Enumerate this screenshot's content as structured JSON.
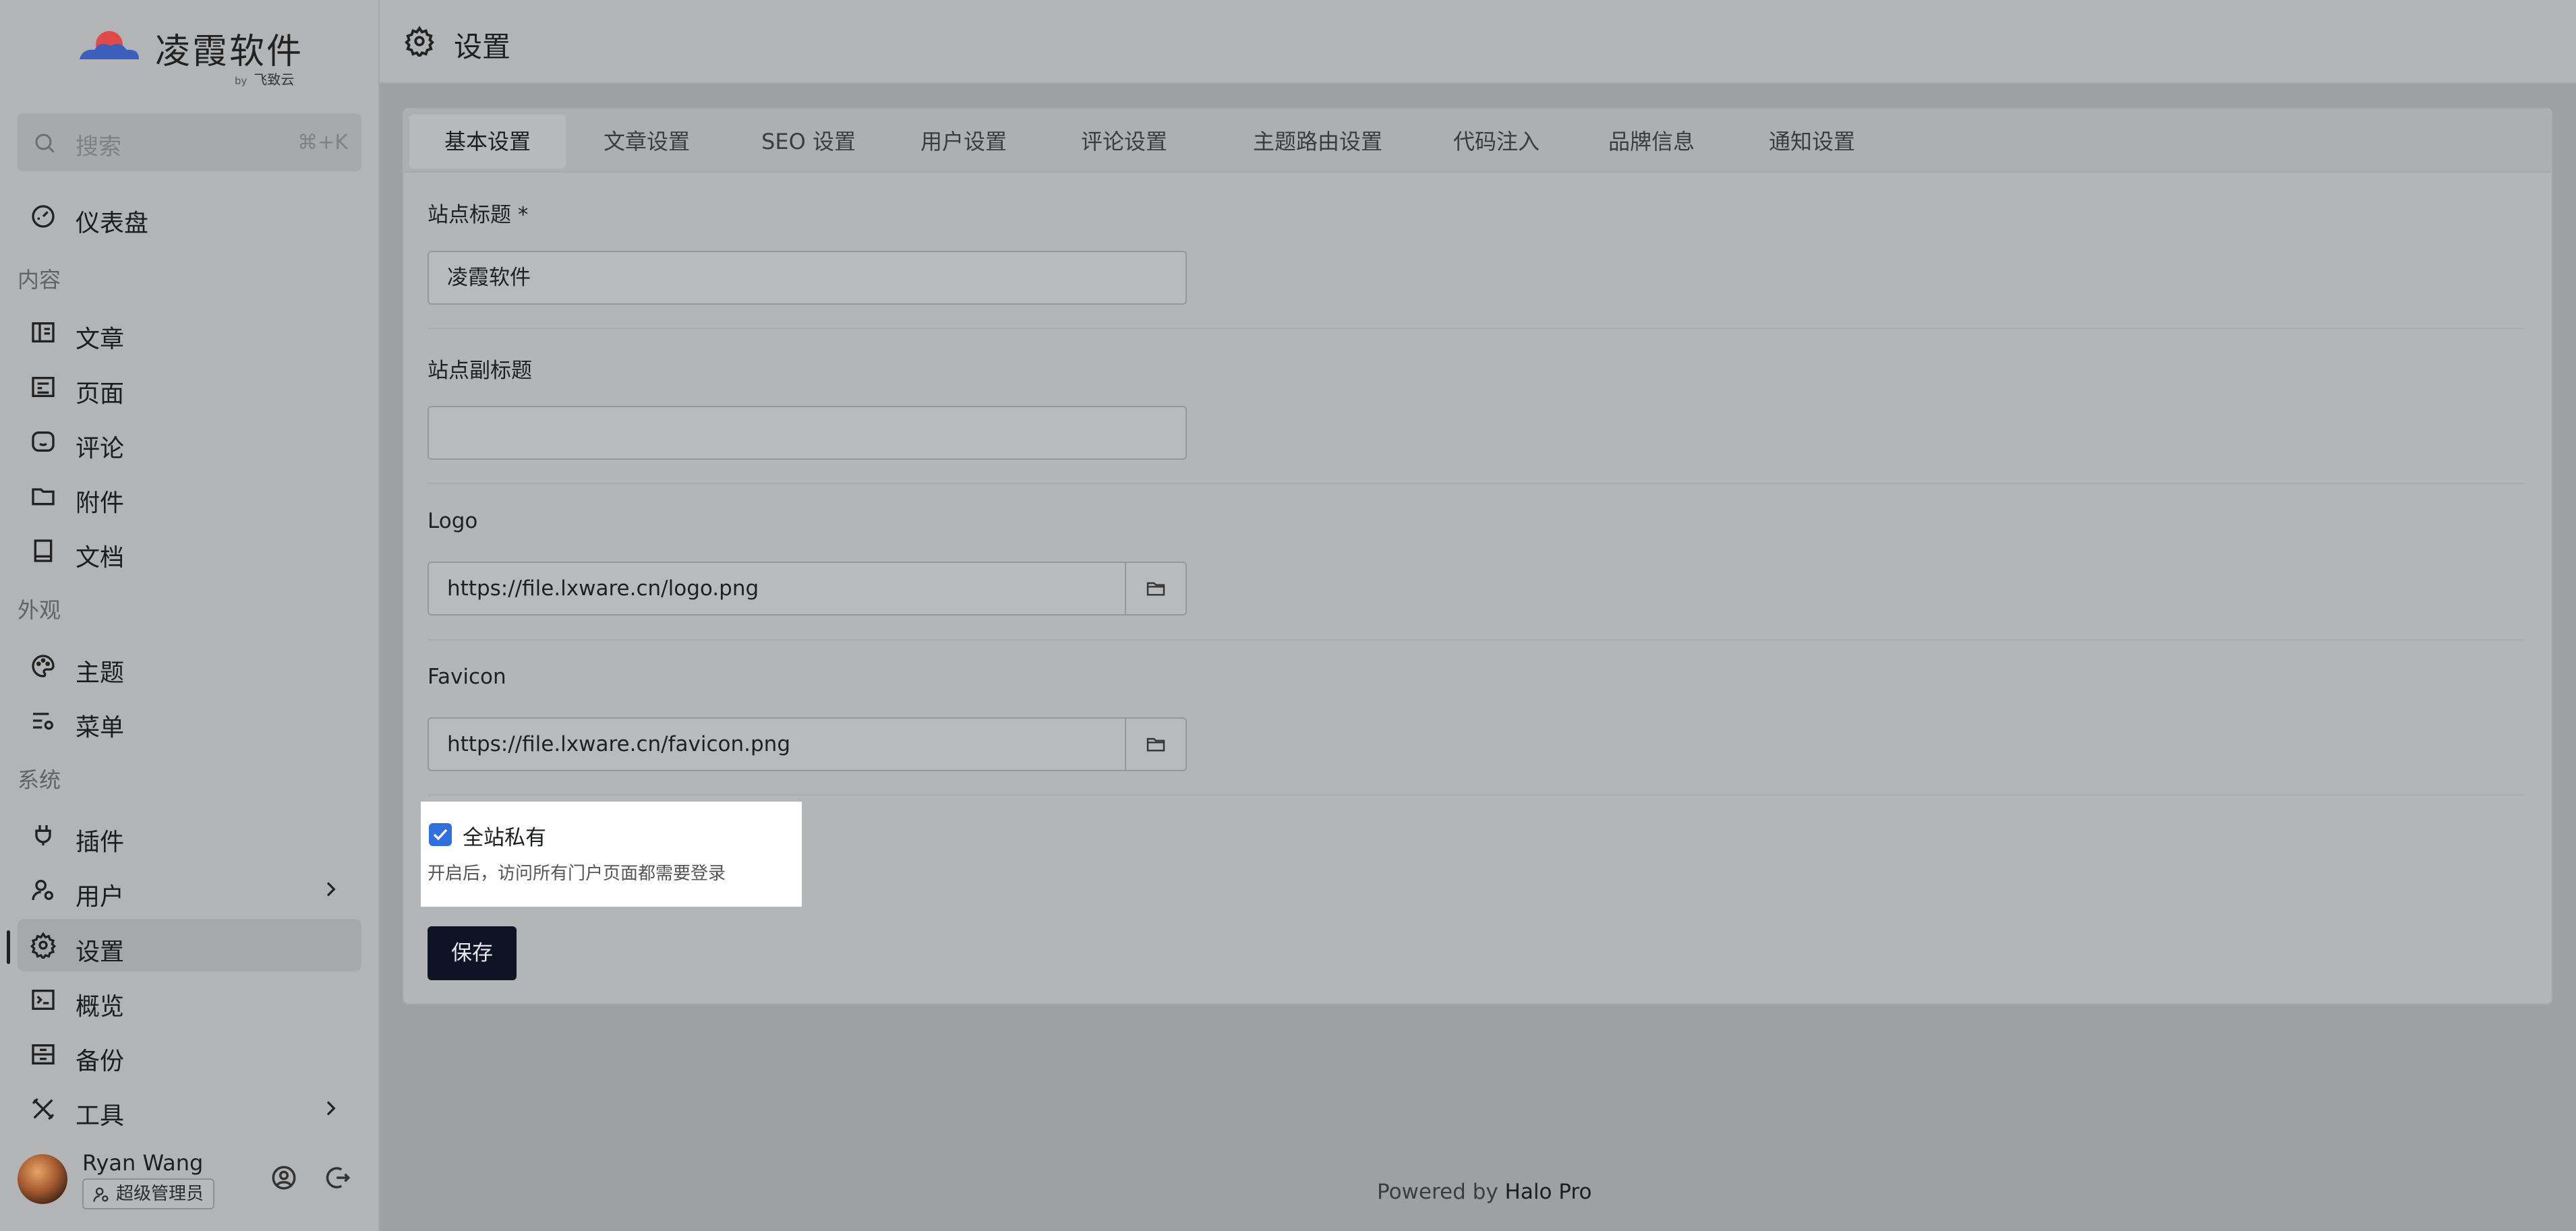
{
  "brand": {
    "name": "凌霞软件",
    "by_prefix": "by",
    "by_name": "飞致云"
  },
  "search": {
    "placeholder": "搜索",
    "shortcut": "⌘+K"
  },
  "sidebar": {
    "dashboard": "仪表盘",
    "groups": {
      "content": "内容",
      "appearance": "外观",
      "system": "系统"
    },
    "content_items": [
      "文章",
      "页面",
      "评论",
      "附件",
      "文档"
    ],
    "appearance_items": [
      "主题",
      "菜单"
    ],
    "system_items": [
      "插件",
      "用户",
      "设置",
      "概览",
      "备份",
      "工具"
    ]
  },
  "user": {
    "name": "Ryan Wang",
    "role": "超级管理员"
  },
  "header": {
    "title": "设置"
  },
  "tabs": [
    "基本设置",
    "文章设置",
    "SEO 设置",
    "用户设置",
    "评论设置",
    "主题路由设置",
    "代码注入",
    "品牌信息",
    "通知设置"
  ],
  "form": {
    "site_title_label": "站点标题 *",
    "site_title_value": "凌霞软件",
    "site_subtitle_label": "站点副标题",
    "site_subtitle_value": "",
    "logo_label": "Logo",
    "logo_value": "https://file.lxware.cn/logo.png",
    "favicon_label": "Favicon",
    "favicon_value": "https://file.lxware.cn/favicon.png",
    "private_label": "全站私有",
    "private_help": "开启后，访问所有门户页面都需要登录",
    "private_checked": true,
    "save_label": "保存"
  },
  "footer": {
    "prefix": "Powered by",
    "brand": "Halo Pro"
  },
  "colors": {
    "accent": "#2f6fe0",
    "save_button": "#0e1424"
  }
}
